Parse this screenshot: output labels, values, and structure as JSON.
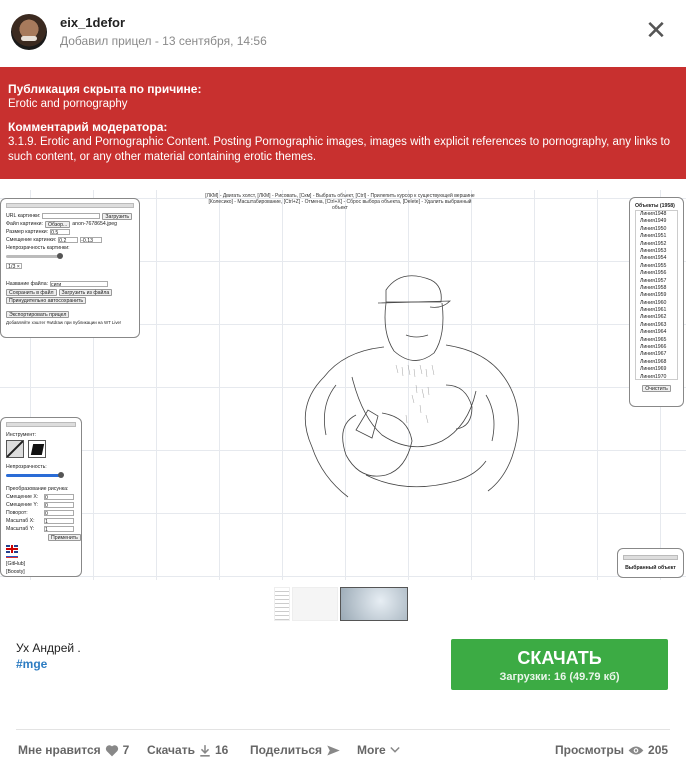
{
  "post": {
    "username": "eix_1defor",
    "subline": "Добавил прицел - 13 сентября, 14:56",
    "close_glyph": "✕"
  },
  "banner": {
    "reason_title": "Публикация скрыта по причине:",
    "reason_text": "Erotic and pornography",
    "moderator_title": "Комментарий модератора:",
    "moderator_text": "3.1.9. Erotic and Pornographic Content. Posting Pornographic images, images with explicit references to pornography, any links to such content, or any other material containing erotic themes.",
    "color": "#c8302f"
  },
  "screenshot": {
    "hint_line1": "[ЛКМ] - Двигать холст, [ЛКМ] - Рисовать, [Скм] - Выбрать объект, [Ctrl] - Прилепить курсор к существующей вершине",
    "hint_line2": "[Колесико] - Масштабирование, [Ctrl+Z] - Отмена, [Ctrl+X] - Сброс выбора объекта, [Delete] - Удалить выбранный объект",
    "left_panel": {
      "url_label": "URL картинки:",
      "load_btn": "Загрузить",
      "file_label": "Файл картинки:",
      "browse_btn": "Обзор...",
      "file_name": "anon-7678654.jpeg",
      "size_label": "Размер картинки:",
      "size_value": "0.5",
      "offset_label": "Смещение картинки:",
      "offset_x": "0.2",
      "offset_y": "-0.13",
      "opacity_label": "Непрозрачность картинки:",
      "scale_select": "1/3 ×",
      "filename_label": "Название файла:",
      "filename_value": "сиги",
      "save_file_btn": "Сохранить в файл",
      "load_file_btn": "Загрузить из файла",
      "autosave_btn": "Принудительно автосохранить",
      "export_btn": "Экспортировать прицел",
      "note": "Добавляйте хэштег #wtdraw при публикации на WT Live!"
    },
    "tool_panel": {
      "tool_label": "Инструмент:",
      "opacity_label": "Непрозрачность:",
      "transform_label": "Преобразование рисунка:",
      "fields": [
        {
          "label": "Смещение X:",
          "value": "0"
        },
        {
          "label": "Смещение Y:",
          "value": "0"
        },
        {
          "label": "Поворот:",
          "value": "0"
        },
        {
          "label": "Масштаб X:",
          "value": "1"
        },
        {
          "label": "Масштаб Y:",
          "value": "1"
        }
      ],
      "apply_btn": "Применить",
      "github": "[GitHub]",
      "boosty": "[Boosty]"
    },
    "objects_panel": {
      "title": "Объекты (1958)",
      "items": [
        "Линия1948",
        "Линия1949",
        "Линия1950",
        "Линия1951",
        "Линия1952",
        "Линия1953",
        "Линия1954",
        "Линия1955",
        "Линия1956",
        "Линия1957",
        "Линия1958",
        "Линия1959",
        "Линия1960",
        "Линия1961",
        "Линия1962",
        "Линия1963",
        "Линия1964",
        "Линия1965",
        "Линия1966",
        "Линия1967",
        "Линия1968",
        "Линия1969",
        "Линия1970",
        "Линия1971",
        "Линия1972",
        "Линия1973"
      ],
      "clear_btn": "Очистить"
    },
    "selected_panel": {
      "title": "Выбранный объект"
    }
  },
  "info": {
    "author": "Ух Андрей .",
    "tag": "#mge"
  },
  "download": {
    "label": "СКАЧАТЬ",
    "stats": "Загрузки: 16 (49.79 кб)",
    "color": "#3cab44"
  },
  "actions": {
    "like_label": "Мне нравится",
    "like_count": "7",
    "download_label": "Скачать",
    "download_count": "16",
    "share_label": "Поделиться",
    "more_label": "More",
    "views_label": "Просмотры",
    "views_count": "205"
  }
}
